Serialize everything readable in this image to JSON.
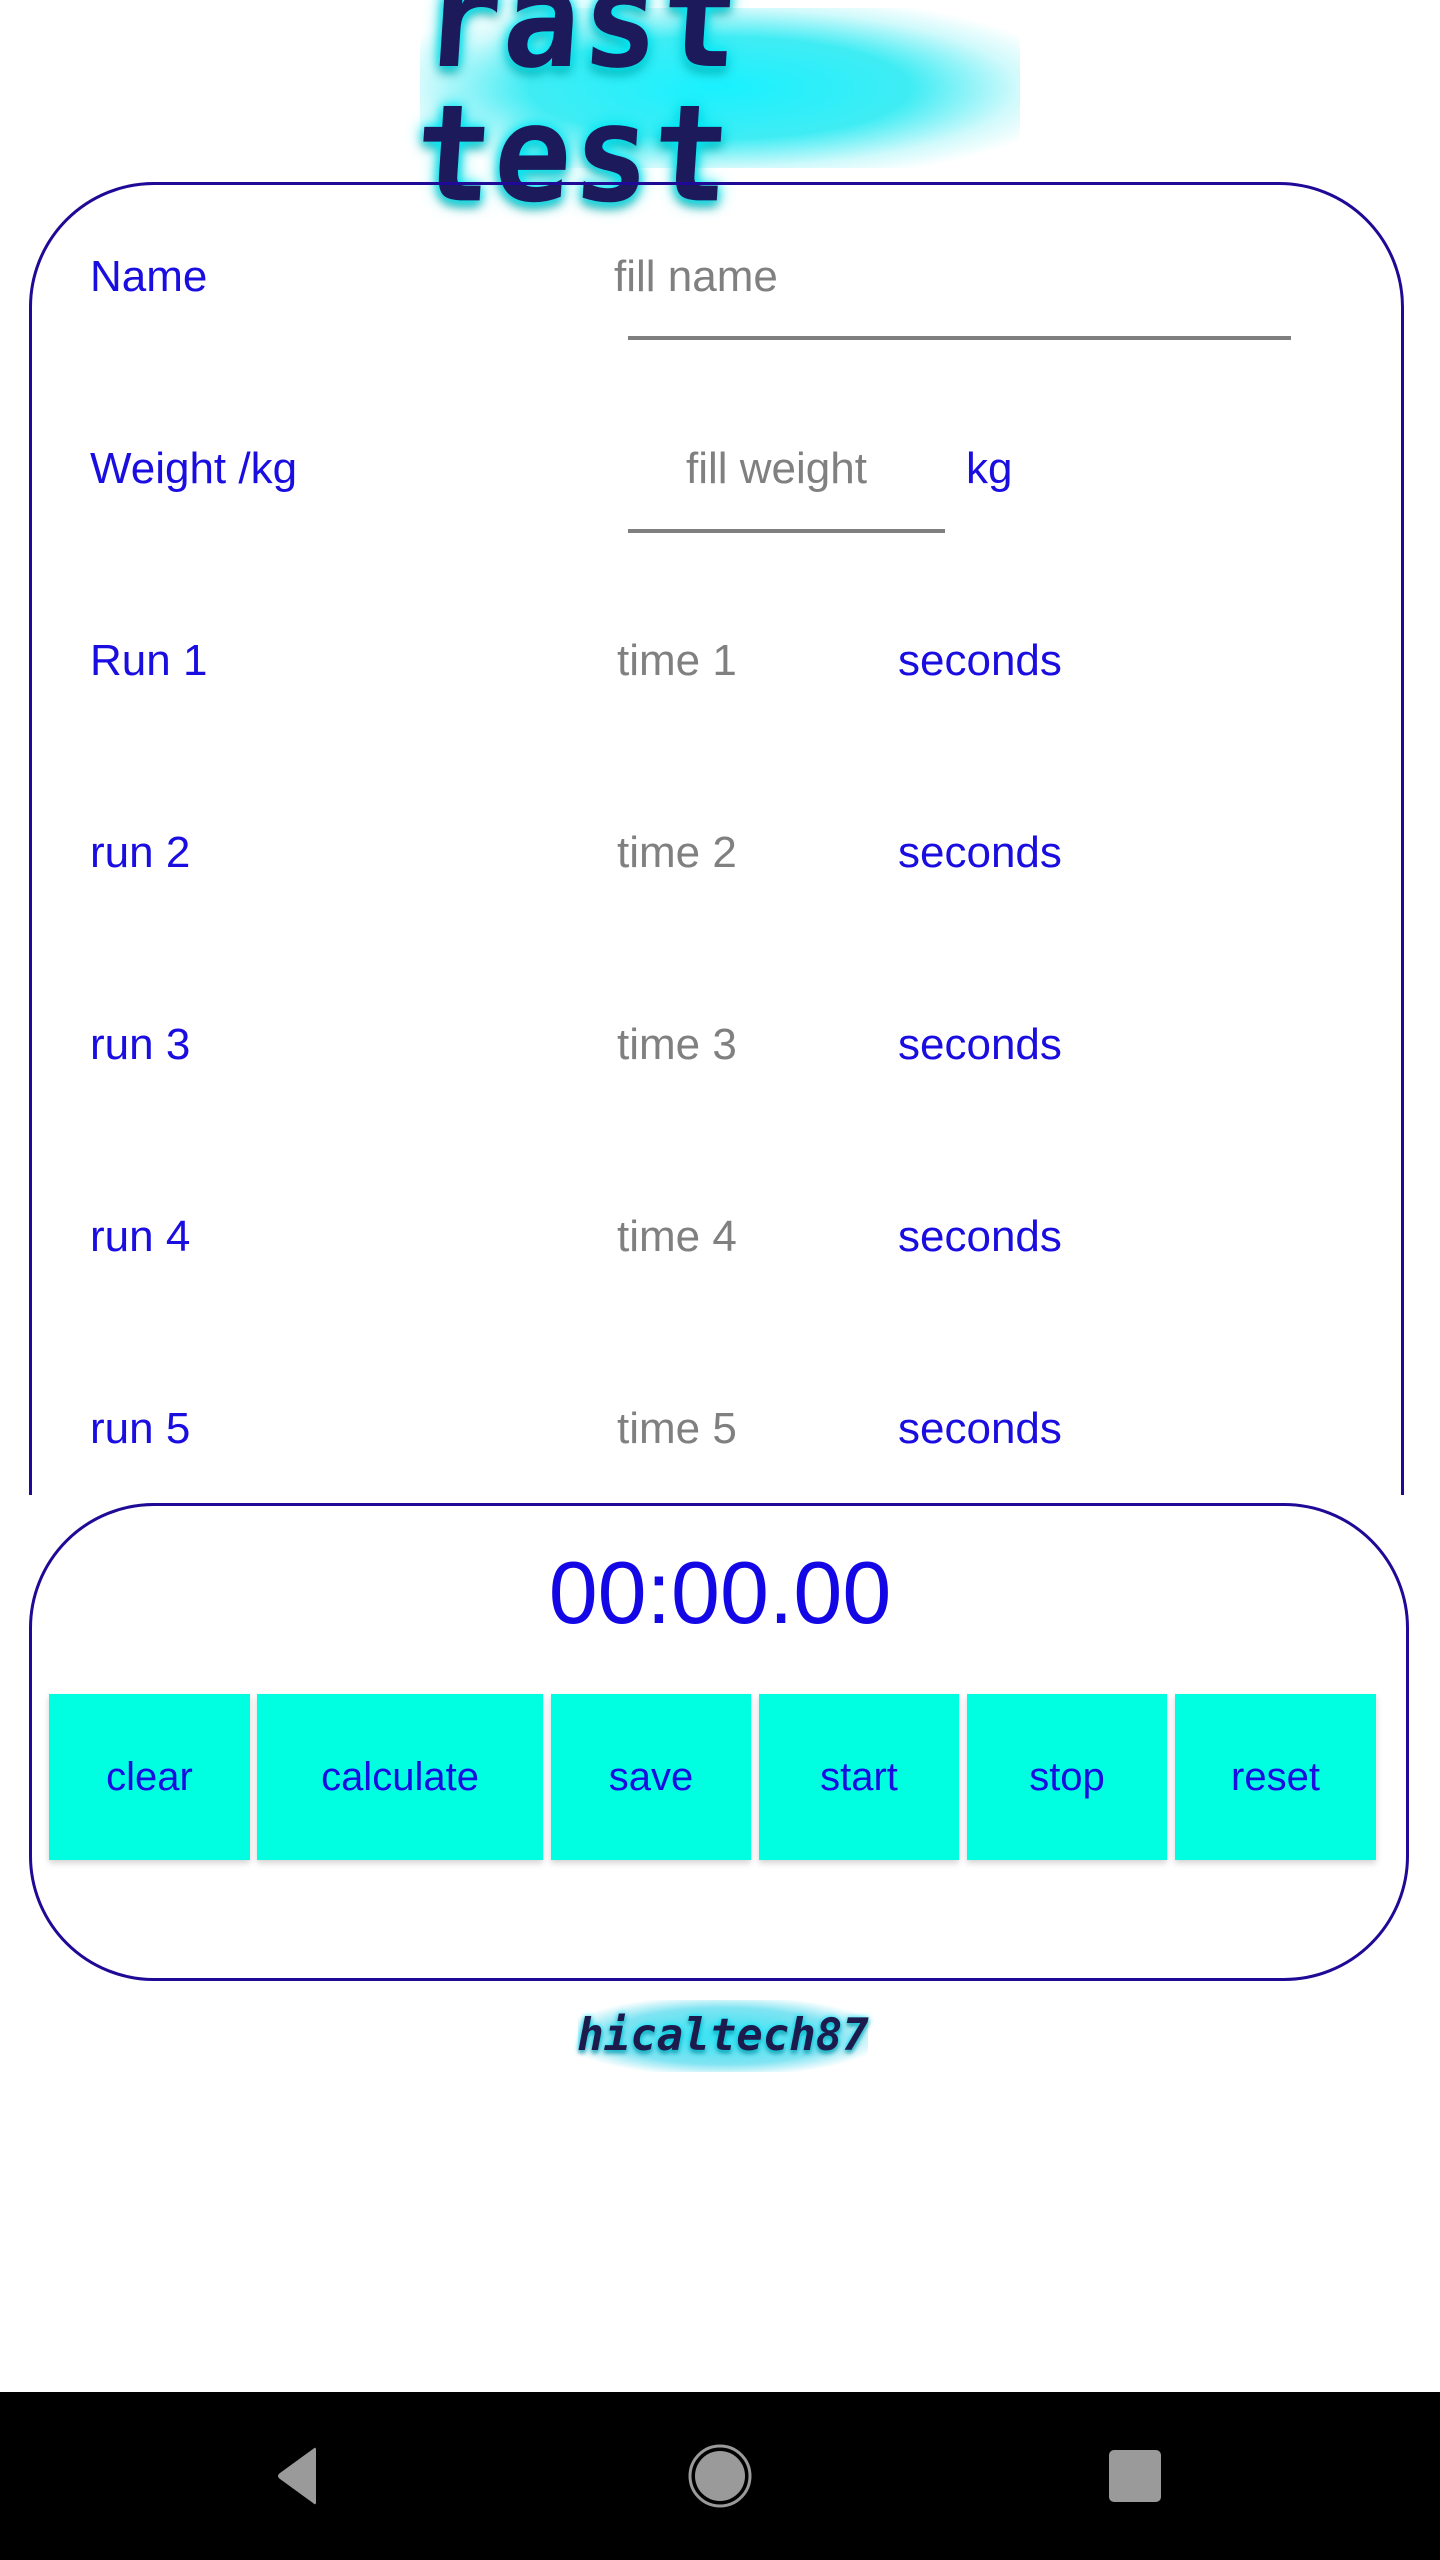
{
  "app": {
    "title_logo": "rast test",
    "footer_logo": "hicaltech87"
  },
  "form": {
    "name": {
      "label": "Name",
      "placeholder": "fill name",
      "value": ""
    },
    "weight": {
      "label": "Weight /kg",
      "placeholder": "fill weight",
      "value": "",
      "unit": "kg"
    },
    "runs": [
      {
        "label": "Run 1",
        "placeholder": "time 1",
        "value": "",
        "unit": "seconds"
      },
      {
        "label": "run 2",
        "placeholder": "time 2",
        "value": "",
        "unit": "seconds"
      },
      {
        "label": "run 3",
        "placeholder": "time 3",
        "value": "",
        "unit": "seconds"
      },
      {
        "label": "run 4",
        "placeholder": "time 4",
        "value": "",
        "unit": "seconds"
      },
      {
        "label": "run 5",
        "placeholder": "time 5",
        "value": "",
        "unit": "seconds"
      }
    ]
  },
  "timer": {
    "display": "00:00.00"
  },
  "buttons": {
    "clear": "clear",
    "calculate": "calculate",
    "save": "save",
    "start": "start",
    "stop": "stop",
    "reset": "reset"
  },
  "nav_bar": {
    "back": "back-icon",
    "home": "home-icon",
    "recents": "recents-icon"
  },
  "colors": {
    "label_blue": "#1a0de0",
    "border_navy": "#1e0a96",
    "button_cyan": "#00ffe1",
    "placeholder_gray": "#808080",
    "nav_bar": "#000000"
  }
}
